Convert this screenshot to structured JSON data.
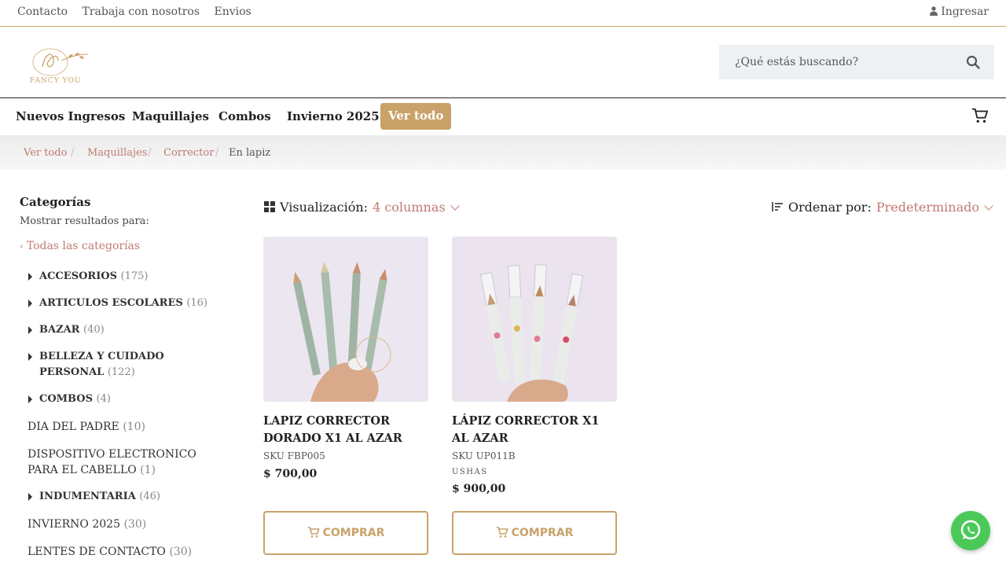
{
  "topbar": {
    "links": [
      "Contacto",
      "Trabaja con nosotros",
      "Envios"
    ],
    "login_label": "Ingresar"
  },
  "header": {
    "logo_text": "FANCY YOU",
    "search_placeholder": "¿Qué estás buscando?"
  },
  "nav": {
    "items": [
      "Nuevos Ingresos",
      "Maquillajes",
      "Combos",
      "Invierno 2025"
    ],
    "cta_label": "Ver todo"
  },
  "breadcrumb": [
    "Ver todo",
    "Maquillajes",
    "Corrector",
    "En lapiz"
  ],
  "sidebar": {
    "title": "Categorías",
    "subtitle": "Mostrar resultados para:",
    "all_label": "Todas las categorías",
    "categories": [
      {
        "label": "ACCESORIOS",
        "count": "(175)"
      },
      {
        "label": "ARTICULOS ESCOLARES",
        "count": "(16)"
      },
      {
        "label": "BAZAR",
        "count": "(40)"
      },
      {
        "label": "BELLEZA Y CUIDADO PERSONAL",
        "count": "(122)"
      },
      {
        "label": "COMBOS",
        "count": "(4)"
      },
      {
        "label": "DIA DEL PADRE",
        "count": "(10)"
      },
      {
        "label": "DISPOSITIVO ELECTRONICO PARA EL CABELLO",
        "count": "(1)"
      },
      {
        "label": "INDUMENTARIA",
        "count": "(46)"
      },
      {
        "label": "INVIERNO 2025",
        "count": "(30)"
      },
      {
        "label": "LENTES DE CONTACTO",
        "count": "(30)"
      }
    ]
  },
  "toolbar": {
    "view_label": "Visualización:",
    "view_value": "4 columnas",
    "sort_label": "Ordenar por:",
    "sort_value": "Predeterminado"
  },
  "products": [
    {
      "name": "LAPIZ CORRECTOR DORADO X1 AL AZAR",
      "sku": "SKU FBP005",
      "brand": "",
      "price": "$  700,00",
      "button": "COMPRAR"
    },
    {
      "name": "LÁPIZ CORRECTOR X1 AL AZAR",
      "sku": "SKU UP011B",
      "brand": "USHAS",
      "price": "$  900,00",
      "button": "COMPRAR"
    }
  ],
  "colors": {
    "accent_gold": "#c9a26a",
    "link_rose": "#c07a72",
    "whatsapp_green": "#4ac959"
  }
}
